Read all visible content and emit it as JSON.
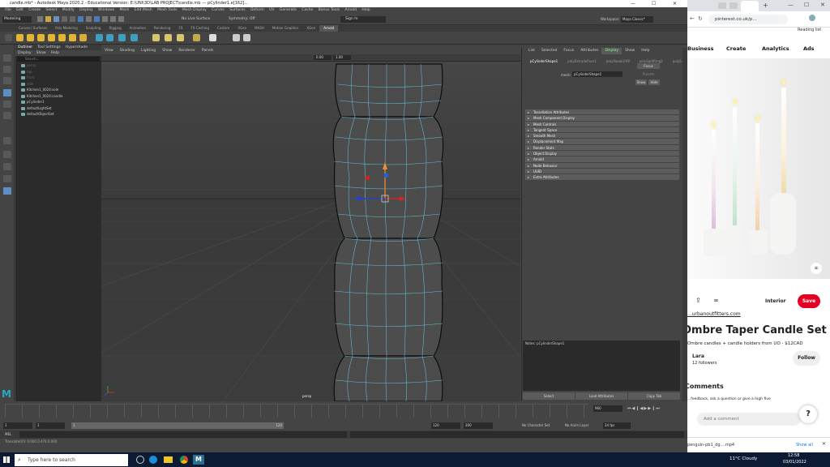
{
  "window": {
    "title": "candle.mb* - Autodesk Maya 2020.2 - Educational Version: E:\\UNI\\3D\\LAB PROJECT\\candle.mb  ---  pCylinder1.e[162]..."
  },
  "menus": [
    "File",
    "Edit",
    "Create",
    "Select",
    "Modify",
    "Display",
    "Windows",
    "Mesh",
    "Edit Mesh",
    "Mesh Tools",
    "Mesh Display",
    "Curves",
    "Surfaces",
    "Deform",
    "UV",
    "Generate",
    "Cache",
    "Bonus Tools",
    "Arnold",
    "Help"
  ],
  "status": {
    "mode": "Modeling",
    "live": "No Live Surface",
    "symmetry": "Symmetry: Off",
    "signin": "Sign In",
    "workspace_label": "Workspace:",
    "workspace": "Maya Classic*"
  },
  "shelf_tabs": [
    {
      "label": "Curves / Surfaces"
    },
    {
      "label": "Poly Modeling"
    },
    {
      "label": "Sculpting"
    },
    {
      "label": "Rigging"
    },
    {
      "label": "Animation"
    },
    {
      "label": "Rendering"
    },
    {
      "label": "FX"
    },
    {
      "label": "FX Caching"
    },
    {
      "label": "Custom"
    },
    {
      "label": "XGen"
    },
    {
      "label": "MASH"
    },
    {
      "label": "Motion Graphics"
    },
    {
      "label": "XGen"
    },
    {
      "label": "Arnold",
      "active": true
    }
  ],
  "outliner": {
    "tabs": [
      "Outliner",
      "Tool Settings",
      "Hypershade"
    ],
    "menu": [
      "Display",
      "Show",
      "Help"
    ],
    "search": "Search...",
    "items": [
      {
        "label": "persp",
        "dim": true
      },
      {
        "label": "top",
        "dim": true
      },
      {
        "label": "front",
        "dim": true
      },
      {
        "label": "side",
        "dim": true
      },
      {
        "label": "Kitchen1_0024:sole"
      },
      {
        "label": "Kitchen1_0024:candle"
      },
      {
        "label": "pCylinder1"
      },
      {
        "label": "defaultLightSet"
      },
      {
        "label": "defaultObjectSet"
      }
    ]
  },
  "viewport": {
    "menu": [
      "View",
      "Shading",
      "Lighting",
      "Show",
      "Renderer",
      "Panels"
    ],
    "field1": "0.00",
    "field2": "1.00",
    "camera": "persp"
  },
  "attribute_editor": {
    "tabs": [
      "List",
      "Selected",
      "Focus",
      "Attributes",
      "Display",
      "Show",
      "Help"
    ],
    "active_tab": "Display",
    "node_tabs": [
      "pCylinderShape1",
      "polyExtrudeFace1",
      "polyTweakUV8",
      "polySplitRing2",
      "polyS..."
    ],
    "mesh_label": "mesh:",
    "mesh_value": "pCylinderShape1",
    "focus": "Focus",
    "presets": "Presets",
    "show": "Show",
    "hide": "Hide",
    "sections": [
      "Tessellation Attributes",
      "Mesh Component Display",
      "Mesh Controls",
      "Tangent Space",
      "Smooth Mesh",
      "Displacement Map",
      "Render Stats",
      "Object Display",
      "Arnold",
      "Node Behavior",
      "UUID",
      "Extra Attributes"
    ],
    "notes_label": "Notes: pCylinderShape1",
    "buttons": [
      "Select",
      "Load Attributes",
      "Copy Tab"
    ]
  },
  "timeline": {
    "start": "1",
    "current": "1",
    "range_start": "1",
    "range_end": "120",
    "end1": "120",
    "end2": "200",
    "frame": "960",
    "char_set": "No Character Set",
    "anim_layer": "No Anim Layer",
    "fps": "24 fps"
  },
  "mel": {
    "label": "MEL"
  },
  "help_line": "Translate/UV: 0.000   0.470   0.000",
  "taskbar": {
    "search": "Type here to search",
    "weather": "11°C  Cloudy",
    "time": "12:58",
    "date": "03/01/2022"
  },
  "browser": {
    "url": "pinterest.co.uk/p...",
    "reading_list": "Reading list",
    "nav": [
      "Business",
      "Create",
      "Analytics",
      "Ads"
    ],
    "board": "Interior",
    "save": "Save",
    "source": "...urbanoutfitters.com",
    "title": "Ombre Taper Candle Set",
    "desc": "Ombre candles + candle holders from UO - $12CAD",
    "user": "Lara",
    "followers": "12 followers",
    "follow": "Follow",
    "comments": "Comments",
    "comments_hint": "...feedback, ask a question or give a high five",
    "add_comment": "Add a comment",
    "download": "penguin-pb1_dg....mp4",
    "show_all": "Show all"
  }
}
